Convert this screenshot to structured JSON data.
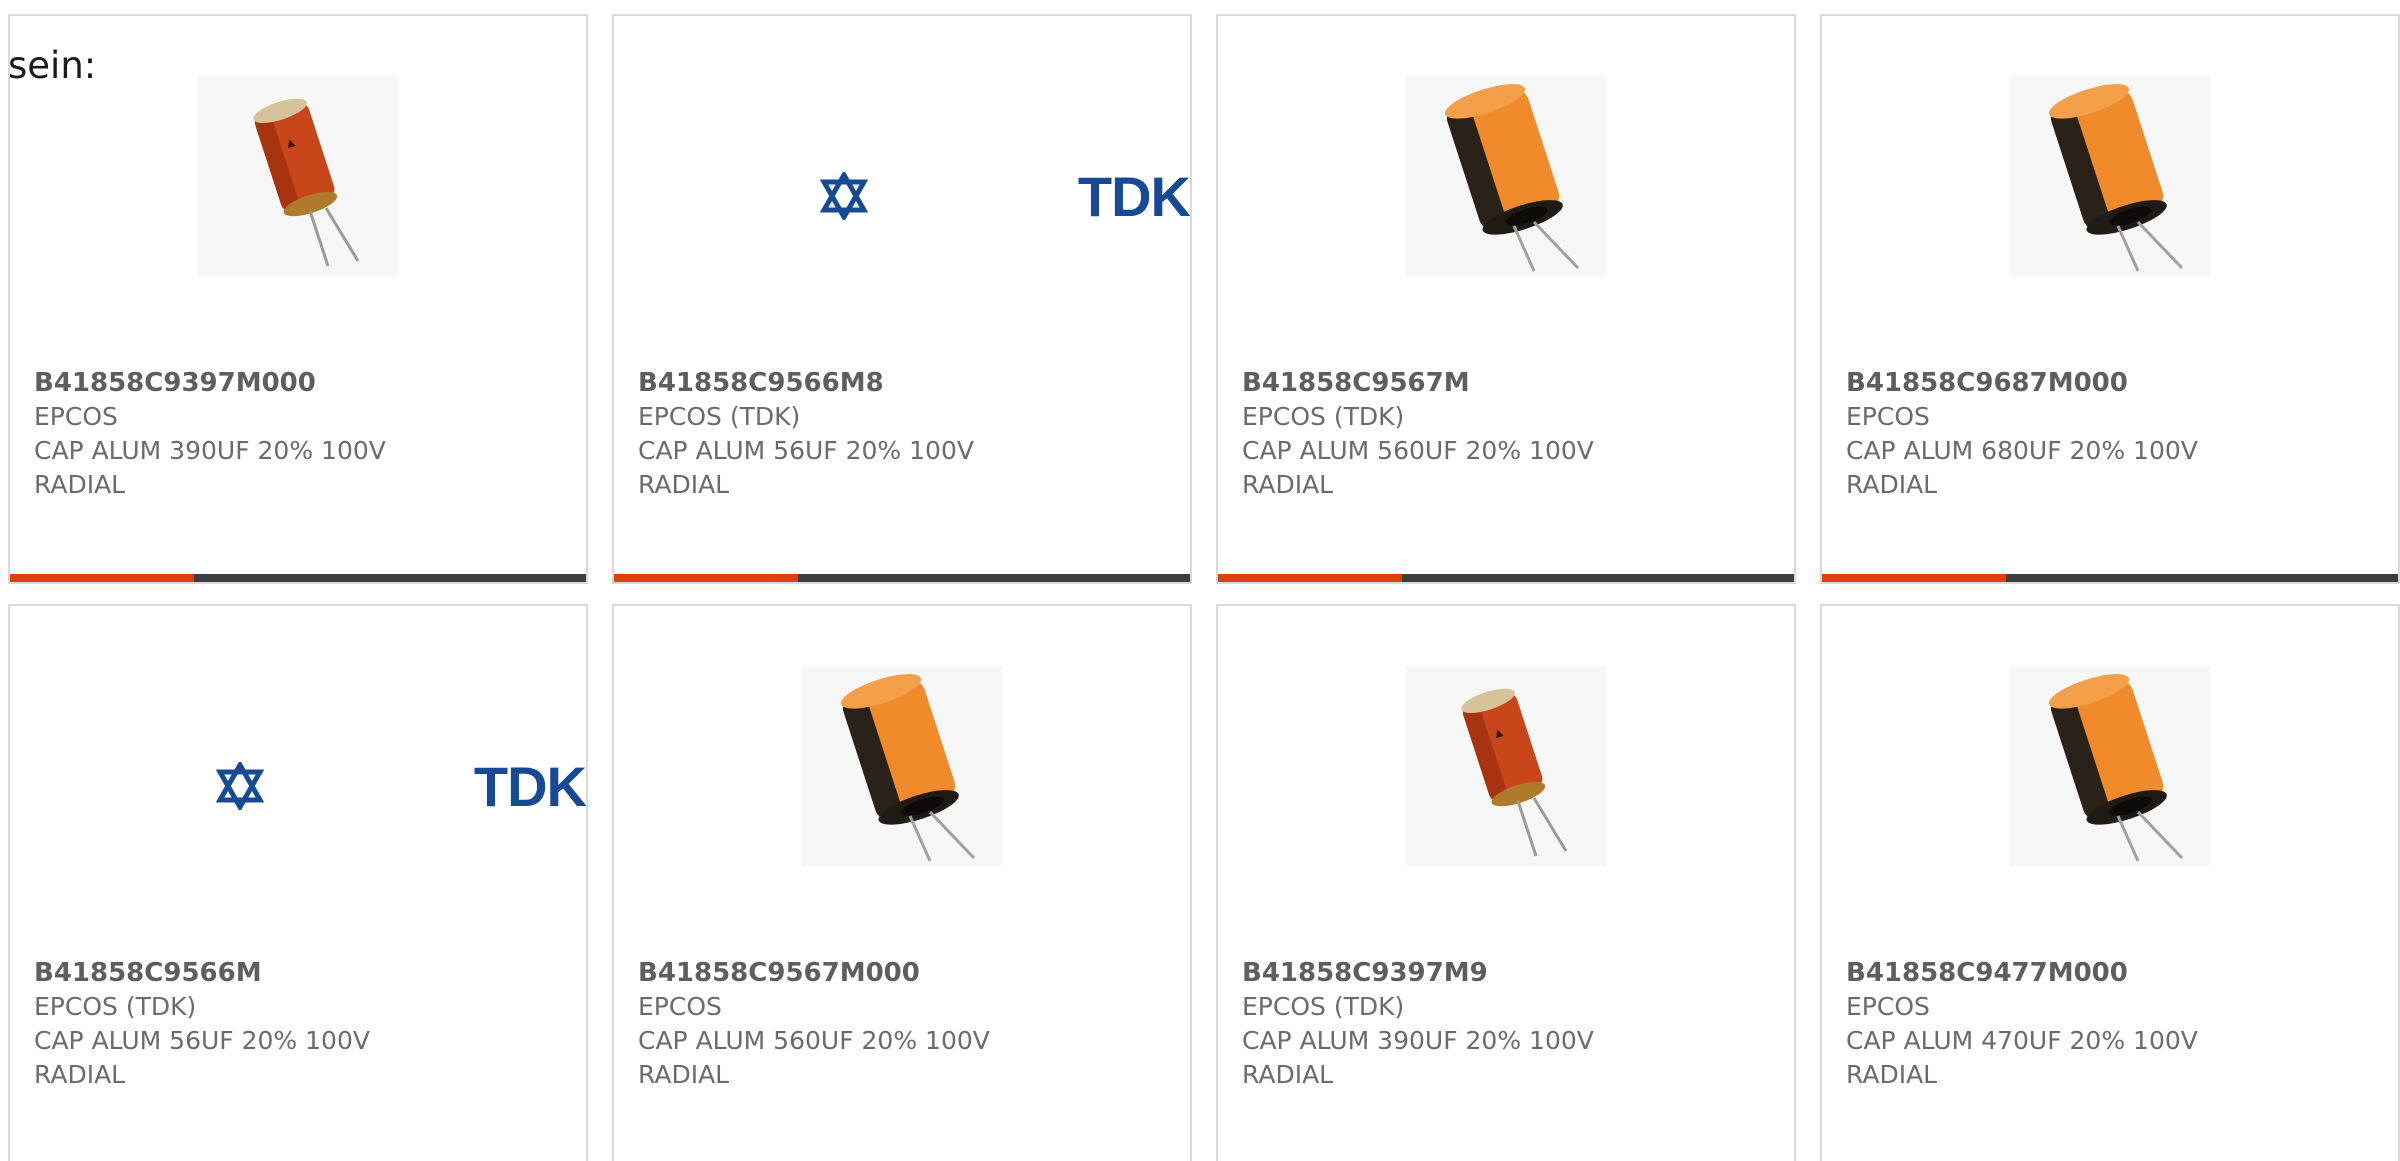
{
  "intro": {
    "text": "sein:"
  },
  "colors": {
    "card_border": "#d9d9d9",
    "bar_dark": "#3d3d3d",
    "bar_accent": "#e0400c",
    "tdk_blue": "#164a94",
    "text_gray": "#6b6b6b"
  },
  "products": [
    {
      "part_number": "B41858C9397M000",
      "manufacturer": "EPCOS",
      "description": "CAP ALUM 390UF 20% 100V",
      "mounting": "RADIAL",
      "image": "capacitor-small-red",
      "image_text": "",
      "progress": 0.32
    },
    {
      "part_number": "B41858C9566M8",
      "manufacturer": "EPCOS (TDK)",
      "description": "CAP ALUM 56UF 20% 100V",
      "mounting": "RADIAL",
      "image": "tdk-logo",
      "image_text": "TDK",
      "progress": 0.32
    },
    {
      "part_number": "B41858C9567M",
      "manufacturer": "EPCOS (TDK)",
      "description": "CAP ALUM 560UF 20% 100V",
      "mounting": "RADIAL",
      "image": "capacitor-large-orange",
      "image_text": "",
      "progress": 0.32
    },
    {
      "part_number": "B41858C9687M000",
      "manufacturer": "EPCOS",
      "description": "CAP ALUM 680UF 20% 100V",
      "mounting": "RADIAL",
      "image": "capacitor-large-orange",
      "image_text": "",
      "progress": 0.32
    },
    {
      "part_number": "B41858C9566M",
      "manufacturer": "EPCOS (TDK)",
      "description": "CAP ALUM 56UF 20% 100V",
      "mounting": "RADIAL",
      "image": "tdk-logo",
      "image_text": "TDK",
      "progress": 0
    },
    {
      "part_number": "B41858C9567M000",
      "manufacturer": "EPCOS",
      "description": "CAP ALUM 560UF 20% 100V",
      "mounting": "RADIAL",
      "image": "capacitor-large-orange",
      "image_text": "",
      "progress": 0
    },
    {
      "part_number": "B41858C9397M9",
      "manufacturer": "EPCOS (TDK)",
      "description": "CAP ALUM 390UF 20% 100V",
      "mounting": "RADIAL",
      "image": "capacitor-small-red",
      "image_text": "",
      "progress": 0
    },
    {
      "part_number": "B41858C9477M000",
      "manufacturer": "EPCOS",
      "description": "CAP ALUM 470UF 20% 100V",
      "mounting": "RADIAL",
      "image": "capacitor-large-orange",
      "image_text": "",
      "progress": 0
    }
  ]
}
